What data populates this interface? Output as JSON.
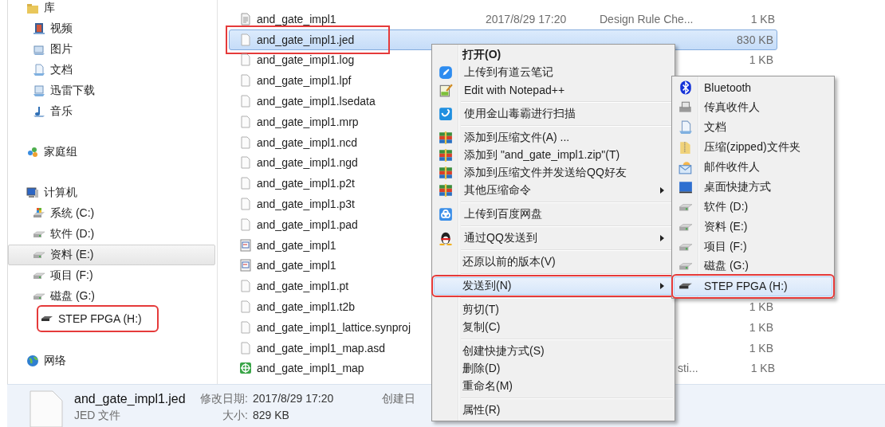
{
  "sidebar": [
    {
      "label": "库",
      "kind": "library",
      "selected": false,
      "annotated": false,
      "children": [
        {
          "label": "视频",
          "kind": "video",
          "selected": false,
          "annotated": false
        },
        {
          "label": "图片",
          "kind": "picture",
          "selected": false,
          "annotated": false
        },
        {
          "label": "文档",
          "kind": "document",
          "selected": false,
          "annotated": false
        },
        {
          "label": "迅雷下载",
          "kind": "download",
          "selected": false,
          "annotated": false
        },
        {
          "label": "音乐",
          "kind": "music",
          "selected": false,
          "annotated": false
        }
      ]
    },
    {
      "label": "家庭组",
      "kind": "homegroup",
      "selected": false,
      "annotated": false
    },
    {
      "label": "计算机",
      "kind": "computer",
      "selected": false,
      "annotated": false,
      "children": [
        {
          "label": "系统 (C:)",
          "kind": "system-drive",
          "selected": false,
          "annotated": false
        },
        {
          "label": "软件 (D:)",
          "kind": "drive",
          "selected": false,
          "annotated": false
        },
        {
          "label": "资料 (E:)",
          "kind": "drive",
          "selected": true,
          "annotated": false
        },
        {
          "label": "项目 (F:)",
          "kind": "drive",
          "selected": false,
          "annotated": false
        },
        {
          "label": "磁盘 (G:)",
          "kind": "drive",
          "selected": false,
          "annotated": false
        },
        {
          "label": "STEP FPGA (H:)",
          "kind": "usb-drive",
          "selected": false,
          "annotated": true
        }
      ]
    },
    {
      "label": "网络",
      "kind": "network",
      "selected": false,
      "annotated": false
    }
  ],
  "files": [
    {
      "name": "and_gate_impl1",
      "kind": "text",
      "date": "2017/8/29 17:20",
      "type": "Design Rule Che...",
      "size": "1 KB",
      "selected": false,
      "annotated": false
    },
    {
      "name": "and_gate_impl1.jed",
      "kind": "blank",
      "size": "830 KB",
      "selected": true,
      "annotated": true
    },
    {
      "name": "and_gate_impl1.log",
      "kind": "blank",
      "size": "1 KB",
      "selected": false,
      "annotated": false
    },
    {
      "name": "and_gate_impl1.lpf",
      "kind": "blank",
      "selected": false,
      "annotated": false
    },
    {
      "name": "and_gate_impl1.lsedata",
      "kind": "blank",
      "selected": false,
      "annotated": false
    },
    {
      "name": "and_gate_impl1.mrp",
      "kind": "blank",
      "selected": false,
      "annotated": false
    },
    {
      "name": "and_gate_impl1.ncd",
      "kind": "blank",
      "selected": false,
      "annotated": false
    },
    {
      "name": "and_gate_impl1.ngd",
      "kind": "blank",
      "selected": false,
      "annotated": false
    },
    {
      "name": "and_gate_impl1.p2t",
      "kind": "blank",
      "selected": false,
      "annotated": false
    },
    {
      "name": "and_gate_impl1.p3t",
      "kind": "blank",
      "selected": false,
      "annotated": false
    },
    {
      "name": "and_gate_impl1.pad",
      "kind": "blank",
      "selected": false,
      "annotated": false
    },
    {
      "name": "and_gate_impl1",
      "kind": "form",
      "selected": false,
      "annotated": false
    },
    {
      "name": "and_gate_impl1",
      "kind": "form",
      "selected": false,
      "annotated": false
    },
    {
      "name": "and_gate_impl1.pt",
      "kind": "blank",
      "selected": false,
      "annotated": false
    },
    {
      "name": "and_gate_impl1.t2b",
      "kind": "blank",
      "size": "1 KB",
      "selected": false,
      "annotated": false
    },
    {
      "name": "and_gate_impl1_lattice.synproj",
      "kind": "blank",
      "size": "1 KB",
      "selected": false,
      "annotated": false
    },
    {
      "name": "and_gate_impl1_map.asd",
      "kind": "blank",
      "size": "1 KB",
      "selected": false,
      "annotated": false
    },
    {
      "name": "and_gate_impl1_map",
      "kind": "map",
      "type": "sti...",
      "size": "1 KB",
      "selected": false,
      "annotated": false
    }
  ],
  "context_menu": {
    "groups": [
      {
        "items": [
          {
            "label": "打开(O)",
            "kind": "none",
            "default": true,
            "submenu": false,
            "selected": false,
            "annotated": false
          },
          {
            "label": "上传到有道云笔记",
            "kind": "youdao",
            "default": false,
            "submenu": false,
            "selected": false,
            "annotated": false
          },
          {
            "label": "Edit with Notepad++",
            "kind": "notepad",
            "default": false,
            "submenu": false,
            "selected": false,
            "annotated": false
          }
        ]
      },
      {
        "items": [
          {
            "label": "使用金山毒霸进行扫描",
            "kind": "shield",
            "default": false,
            "submenu": false,
            "selected": false,
            "annotated": false
          }
        ]
      },
      {
        "items": [
          {
            "label": "添加到压缩文件(A) ...",
            "kind": "archive",
            "default": false,
            "submenu": false,
            "selected": false,
            "annotated": false
          },
          {
            "label": "添加到 \"and_gate_impl1.zip\"(T)",
            "kind": "archive",
            "default": false,
            "submenu": false,
            "selected": false,
            "annotated": false
          },
          {
            "label": "添加到压缩文件并发送给QQ好友",
            "kind": "archive",
            "default": false,
            "submenu": false,
            "selected": false,
            "annotated": false
          },
          {
            "label": "其他压缩命令",
            "kind": "archive",
            "default": false,
            "submenu": true,
            "selected": false,
            "annotated": false
          }
        ]
      },
      {
        "items": [
          {
            "label": "上传到百度网盘",
            "kind": "baidu",
            "default": false,
            "submenu": false,
            "selected": false,
            "annotated": false
          }
        ]
      },
      {
        "items": [
          {
            "label": "通过QQ发送到",
            "kind": "qq",
            "default": false,
            "submenu": true,
            "selected": false,
            "annotated": false
          }
        ]
      },
      {
        "items": [
          {
            "label": "还原以前的版本(V)",
            "kind": "none",
            "default": false,
            "submenu": false,
            "selected": false,
            "annotated": false
          }
        ]
      },
      {
        "items": [
          {
            "label": "发送到(N)",
            "kind": "none",
            "default": false,
            "submenu": true,
            "selected": true,
            "annotated": true
          }
        ]
      },
      {
        "items": [
          {
            "label": "剪切(T)",
            "kind": "none",
            "default": false,
            "submenu": false,
            "selected": false,
            "annotated": false
          },
          {
            "label": "复制(C)",
            "kind": "none",
            "default": false,
            "submenu": false,
            "selected": false,
            "annotated": false
          }
        ]
      },
      {
        "items": [
          {
            "label": "创建快捷方式(S)",
            "kind": "none",
            "default": false,
            "submenu": false,
            "selected": false,
            "annotated": false
          },
          {
            "label": "删除(D)",
            "kind": "none",
            "default": false,
            "submenu": false,
            "selected": false,
            "annotated": false
          },
          {
            "label": "重命名(M)",
            "kind": "none",
            "default": false,
            "submenu": false,
            "selected": false,
            "annotated": false
          }
        ]
      },
      {
        "items": [
          {
            "label": "属性(R)",
            "kind": "none",
            "default": false,
            "submenu": false,
            "selected": false,
            "annotated": false
          }
        ]
      }
    ]
  },
  "send_to_menu": {
    "items": [
      {
        "label": "Bluetooth",
        "kind": "bluetooth",
        "selected": false,
        "annotated": false
      },
      {
        "label": "传真收件人",
        "kind": "fax",
        "selected": false,
        "annotated": false
      },
      {
        "label": "文档",
        "kind": "document",
        "selected": false,
        "annotated": false
      },
      {
        "label": "压缩(zipped)文件夹",
        "kind": "zip-folder",
        "selected": false,
        "annotated": false
      },
      {
        "label": "邮件收件人",
        "kind": "mail",
        "selected": false,
        "annotated": false
      },
      {
        "label": "桌面快捷方式",
        "kind": "desktop",
        "selected": false,
        "annotated": false
      },
      {
        "label": "软件 (D:)",
        "kind": "drive",
        "selected": false,
        "annotated": false
      },
      {
        "label": "资料 (E:)",
        "kind": "drive",
        "selected": false,
        "annotated": false
      },
      {
        "label": "项目 (F:)",
        "kind": "drive",
        "selected": false,
        "annotated": false
      },
      {
        "label": "磁盘 (G:)",
        "kind": "drive",
        "selected": false,
        "annotated": false
      },
      {
        "label": "STEP FPGA (H:)",
        "kind": "usb-drive",
        "selected": true,
        "annotated": true
      }
    ]
  },
  "details_pane": {
    "file_name": "and_gate_impl1.jed",
    "file_type": "JED 文件",
    "modified_label": "修改日期:",
    "modified_value": "2017/8/29 17:20",
    "size_label": "大小:",
    "size_value": "829 KB",
    "created_label": "创建日"
  }
}
